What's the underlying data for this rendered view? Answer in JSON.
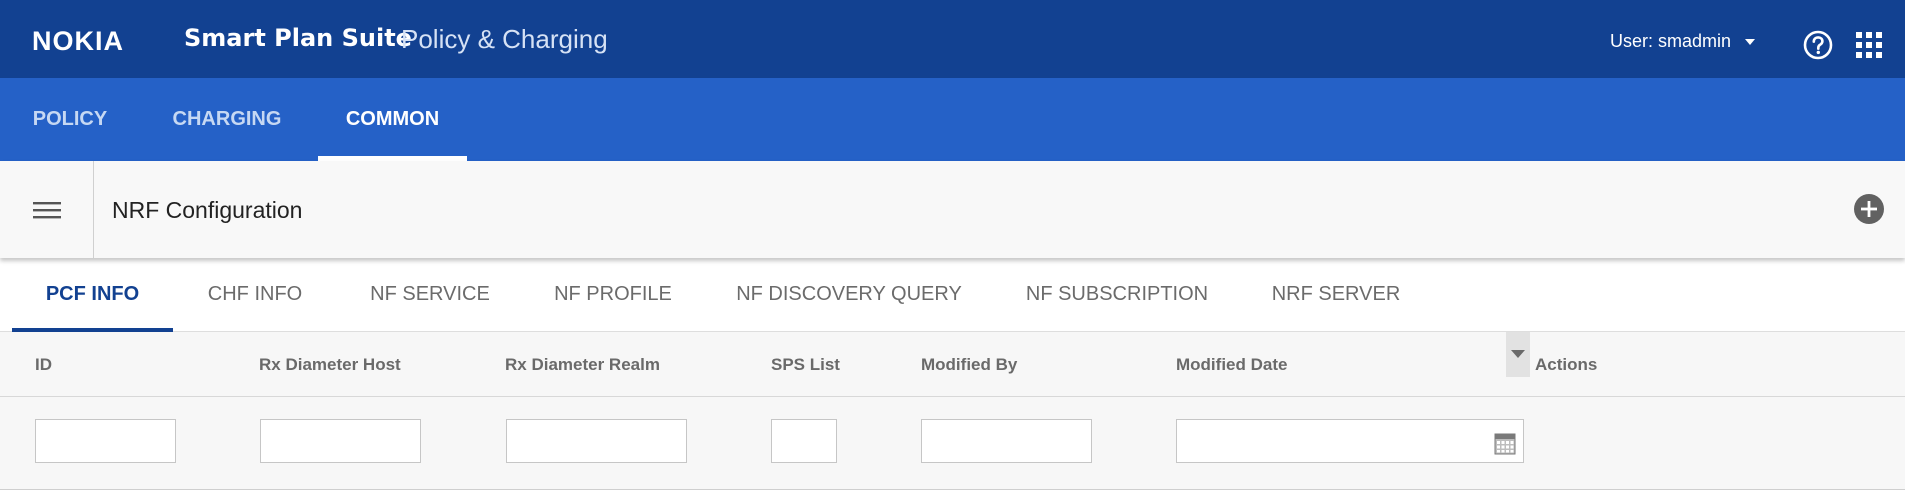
{
  "header": {
    "logo": "NOKIA",
    "app_title": "Smart Plan Suite",
    "app_subtitle": "Policy & Charging",
    "user_label": "User: smadmin",
    "icons": {
      "help": "help-circle-icon",
      "apps": "apps-grid-icon",
      "user_caret": "chevron-down-icon"
    }
  },
  "main_nav": {
    "tabs": [
      {
        "label": "POLICY",
        "active": false
      },
      {
        "label": "CHARGING",
        "active": false
      },
      {
        "label": "COMMON",
        "active": true
      }
    ]
  },
  "page": {
    "title": "NRF Configuration",
    "icons": {
      "menu": "hamburger-menu-icon",
      "add": "add-circle-icon"
    }
  },
  "sub_tabs": [
    {
      "label": "PCF INFO",
      "active": true
    },
    {
      "label": "CHF INFO",
      "active": false
    },
    {
      "label": "NF SERVICE",
      "active": false
    },
    {
      "label": "NF PROFILE",
      "active": false
    },
    {
      "label": "NF DISCOVERY QUERY",
      "active": false
    },
    {
      "label": "NF SUBSCRIPTION",
      "active": false
    },
    {
      "label": "NRF SERVER",
      "active": false
    }
  ],
  "grid": {
    "columns": [
      "ID",
      "Rx Diameter Host",
      "Rx Diameter Realm",
      "SPS List",
      "Modified By",
      "Modified Date",
      "Actions"
    ],
    "filters": {
      "id": "",
      "rx_diameter_host": "",
      "rx_diameter_realm": "",
      "sps_list": "",
      "modified_by": "",
      "modified_date": ""
    },
    "icons": {
      "column_menu": "triangle-down-icon",
      "date_picker": "calendar-icon"
    }
  },
  "colors": {
    "header_bg": "#124191",
    "nav_bg": "#2561c7",
    "active_subtab": "#124191",
    "grid_header_bg": "#f7f7f7"
  }
}
